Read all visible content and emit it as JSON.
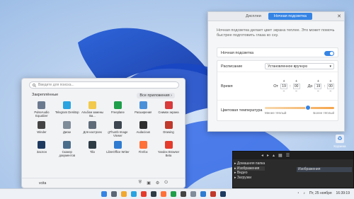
{
  "colors": {
    "accent": "#3584e4",
    "wallpaper": "#a9c5ea"
  },
  "settings": {
    "tabs": [
      "Дисплеи",
      "Ночная подсветка"
    ],
    "active_tab": 1,
    "description": "Ночная подсветка делает цвет экрана теплее. Это может помочь быстрее подготовить глаза ко сну.",
    "night_light_label": "Ночная подсветка",
    "night_light_on": true,
    "schedule_label": "Расписание",
    "schedule_value": "Установленное вручную",
    "time_label": "Время",
    "from_label": "От",
    "from_h": "19",
    "from_m": "00",
    "to_label": "До",
    "to_h": "19",
    "to_m": "00",
    "temp_label": "Цветовая температура",
    "temp_less": "Менее тёплый",
    "temp_more": "Более тёплый",
    "temp_level": 0.62
  },
  "startmenu": {
    "search_placeholder": "Введите для поиска...",
    "favorites_label": "Закреплённые",
    "all_apps_label": "Все приложения ›",
    "apps": [
      {
        "label": "PulseAudio Equalizer",
        "color": "#6b7a8f",
        "icon": "equalizer-icon"
      },
      {
        "label": "Telegram Desktop",
        "color": "#2aa3e0",
        "icon": "telegram-icon"
      },
      {
        "label": "Альбом замены Ва...",
        "color": "#f2c94c",
        "icon": "album-icon"
      },
      {
        "label": "Freeplane",
        "color": "#1f9e4a",
        "icon": "freeplane-icon"
      },
      {
        "label": "Расширения",
        "color": "#4a90d9",
        "icon": "extensions-icon"
      },
      {
        "label": "Снимок экрана",
        "color": "#d93a3a",
        "icon": "screenshot-icon"
      },
      {
        "label": "Winder",
        "color": "#444444",
        "icon": "winder-icon"
      },
      {
        "label": "Диски",
        "color": "#7f8c9a",
        "icon": "disks-icon"
      },
      {
        "label": "Для настроек",
        "color": "#5f6b78",
        "icon": "settings-icon"
      },
      {
        "label": "gThumb Image Viewer",
        "color": "#3c4550",
        "icon": "gthumb-icon"
      },
      {
        "label": "Audacious",
        "color": "#2f2f2f",
        "icon": "audacious-icon"
      },
      {
        "label": "Drawing",
        "color": "#c0392b",
        "icon": "drawing-icon"
      },
      {
        "label": "Заслон",
        "color": "#1e3a5f",
        "icon": "shield-icon"
      },
      {
        "label": "Сканер документов",
        "color": "#4a6d8c",
        "icon": "scanner-icon"
      },
      {
        "label": "Tilix",
        "color": "#2d3b45",
        "icon": "terminal-icon"
      },
      {
        "label": "LibreOffice Writer",
        "color": "#2f7bd1",
        "icon": "writer-icon"
      },
      {
        "label": "Firefox",
        "color": "#ff7139",
        "icon": "firefox-icon"
      },
      {
        "label": "Yandex Browser Beta",
        "color": "#e43b2c",
        "icon": "yandex-icon"
      }
    ],
    "user": "vcita"
  },
  "recycle_label": "Корзина",
  "filemgr": {
    "tree": [
      "Домашняя папка",
      "Изображения",
      "Видео",
      "Загрузки"
    ],
    "selected": "Изображения"
  },
  "taskbar": {
    "date": "Пт, 25 ноября",
    "time": "16:39:19"
  }
}
